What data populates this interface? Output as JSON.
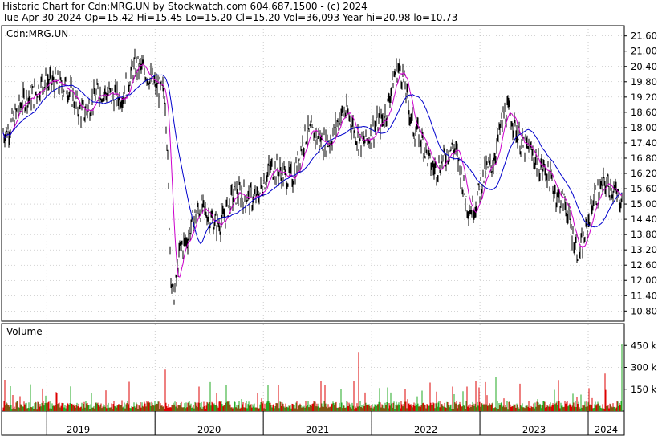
{
  "header": {
    "line1": "Historic Chart for Cdn:MRG.UN by Stockwatch.com 604.687.1500 - (c) 2024",
    "line2": "Tue Apr 30 2024   Op=15.42   Hi=15.45   Lo=15.20   Cl=15.20   Vol=36,093   Year hi=20.98   lo=10.73"
  },
  "colors": {
    "price": "#000000",
    "ma_short": "#cc00cc",
    "ma_long": "#0000cc",
    "vol_up": "#22aa22",
    "vol_down": "#dd0000",
    "grid": "#aaaaaa"
  },
  "chart_data": [
    {
      "type": "line",
      "title": "Cdn:MRG.UN",
      "ylim": [
        10.4,
        22.0
      ],
      "y_ticks": [
        "21.60",
        "21.00",
        "20.40",
        "19.80",
        "19.20",
        "18.60",
        "18.00",
        "17.40",
        "16.80",
        "16.20",
        "15.60",
        "15.00",
        "14.40",
        "13.80",
        "13.20",
        "12.60",
        "12.00",
        "11.40",
        "10.80"
      ],
      "x_labels": [
        "2019",
        "2020",
        "2021",
        "2022",
        "2023",
        "2024"
      ],
      "price_keypoints": [
        {
          "x": "2018-08",
          "y": 17.8
        },
        {
          "x": "2018-11",
          "y": 19.2
        },
        {
          "x": "2019-01",
          "y": 19.8
        },
        {
          "x": "2019-03",
          "y": 19.6
        },
        {
          "x": "2019-05",
          "y": 18.6
        },
        {
          "x": "2019-07",
          "y": 19.4
        },
        {
          "x": "2019-09",
          "y": 19.2
        },
        {
          "x": "2019-11",
          "y": 20.4
        },
        {
          "x": "2020-02",
          "y": 19.4
        },
        {
          "x": "2020-03",
          "y": 11.4
        },
        {
          "x": "2020-04",
          "y": 13.4
        },
        {
          "x": "2020-06",
          "y": 14.8
        },
        {
          "x": "2020-08",
          "y": 14.2
        },
        {
          "x": "2020-10",
          "y": 15.4
        },
        {
          "x": "2020-12",
          "y": 15.2
        },
        {
          "x": "2021-02",
          "y": 16.4
        },
        {
          "x": "2021-04",
          "y": 16.0
        },
        {
          "x": "2021-06",
          "y": 17.8
        },
        {
          "x": "2021-08",
          "y": 17.4
        },
        {
          "x": "2021-10",
          "y": 18.6
        },
        {
          "x": "2021-12",
          "y": 17.4
        },
        {
          "x": "2022-02",
          "y": 18.2
        },
        {
          "x": "2022-04",
          "y": 20.3
        },
        {
          "x": "2022-06",
          "y": 17.8
        },
        {
          "x": "2022-08",
          "y": 16.4
        },
        {
          "x": "2022-10",
          "y": 17.2
        },
        {
          "x": "2022-12",
          "y": 14.8
        },
        {
          "x": "2023-02",
          "y": 16.4
        },
        {
          "x": "2023-04",
          "y": 18.6
        },
        {
          "x": "2023-06",
          "y": 17.2
        },
        {
          "x": "2023-08",
          "y": 16.4
        },
        {
          "x": "2023-10",
          "y": 15.2
        },
        {
          "x": "2023-12",
          "y": 13.2
        },
        {
          "x": "2024-02",
          "y": 15.4
        },
        {
          "x": "2024-03",
          "y": 15.8
        },
        {
          "x": "2024-04",
          "y": 15.2
        }
      ]
    },
    {
      "type": "bar",
      "title": "Volume",
      "ylim": [
        0,
        600000
      ],
      "y_ticks": [
        "450 k",
        "300 k",
        "150 k"
      ]
    }
  ]
}
